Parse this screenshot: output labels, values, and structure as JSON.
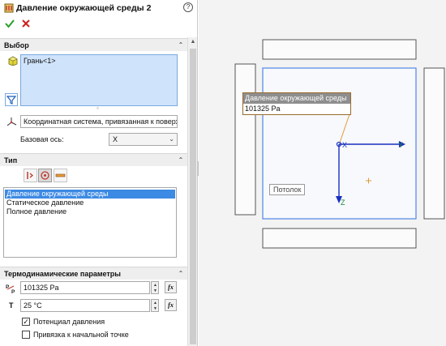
{
  "manager": {
    "title": "Давление окружающей среды 2",
    "help": "?",
    "ok_icon": "checkmark-icon",
    "cancel_icon": "x-icon",
    "accent": "#2a9d2a",
    "cancel_color": "#d02020"
  },
  "selection": {
    "title": "Выбор",
    "items": [
      "Грань<1>"
    ],
    "coord_system": "Координатная система, привязанная к поверх",
    "base_axis_label": "Базовая ось:",
    "base_axis_value": "X"
  },
  "type": {
    "title": "Тип",
    "options": [
      "Давление окружающей среды",
      "Статическое давление",
      "Полное давление"
    ],
    "selected_index": 0
  },
  "thermo": {
    "title": "Термодинамические параметры",
    "pressure_value": "101325 Pa",
    "temperature_label": "T",
    "temperature_value": "25 °C",
    "fx_label": "fx",
    "potential_label": "Потенциал давления",
    "potential_checked": true,
    "reference_label": "Привязка к начальной точке",
    "reference_checked": false
  },
  "viewport": {
    "callout_title": "Давление окружающей среды",
    "callout_value": "101325 Pa",
    "face_label": "Потолок",
    "axis_x": "X",
    "axis_y": "Y",
    "axis_z": "Z",
    "axis_color": "#1a2fbf",
    "face_highlight": "#5b8ee8",
    "callout_accent": "#e39a3b"
  }
}
